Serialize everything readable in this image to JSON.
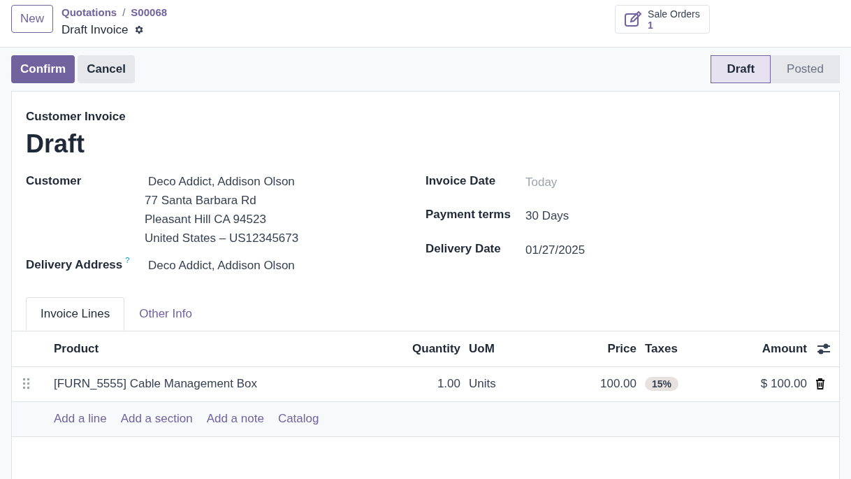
{
  "top_bar": {
    "new_button": "New",
    "breadcrumbs": [
      "Quotations",
      "S00068"
    ],
    "breadcrumb_separator": "/",
    "record_title": "Draft Invoice",
    "smart_button": {
      "label": "Sale Orders",
      "count": "1"
    }
  },
  "actions": [
    "Confirm",
    "Cancel"
  ],
  "status_bar": [
    {
      "label": "Draft",
      "selected": true
    },
    {
      "label": "Posted",
      "selected": false
    }
  ],
  "sheet": {
    "subtitle": "Customer Invoice",
    "title": "Draft",
    "left_fields": [
      {
        "label": "Customer",
        "lines": [
          "Deco Addict, Addison Olson",
          "77 Santa Barbara Rd",
          "Pleasant Hill CA 94523",
          "United States – US12345673"
        ]
      },
      {
        "label": "Delivery Address",
        "help_mark": "?",
        "lines": [
          "Deco Addict, Addison Olson"
        ]
      }
    ],
    "right_fields": [
      {
        "label": "Invoice Date",
        "placeholder": "Today"
      },
      {
        "label": "Payment terms",
        "value": "30 Days"
      },
      {
        "label": "Delivery Date",
        "value": "01/27/2025"
      }
    ],
    "tabs": [
      {
        "label": "Invoice Lines",
        "selected": true
      },
      {
        "label": "Other Info",
        "selected": false
      }
    ],
    "table": {
      "columns": [
        "Product",
        "Quantity",
        "UoM",
        "Price",
        "Taxes",
        "Amount"
      ],
      "rows": [
        {
          "product": "[FURN_5555] Cable Management Box",
          "quantity": "1.00",
          "uom": "Units",
          "price": "100.00",
          "tax": "15%",
          "amount": "$ 100.00"
        }
      ],
      "add_links": [
        "Add a line",
        "Add a section",
        "Add a note",
        "Catalog"
      ]
    }
  }
}
